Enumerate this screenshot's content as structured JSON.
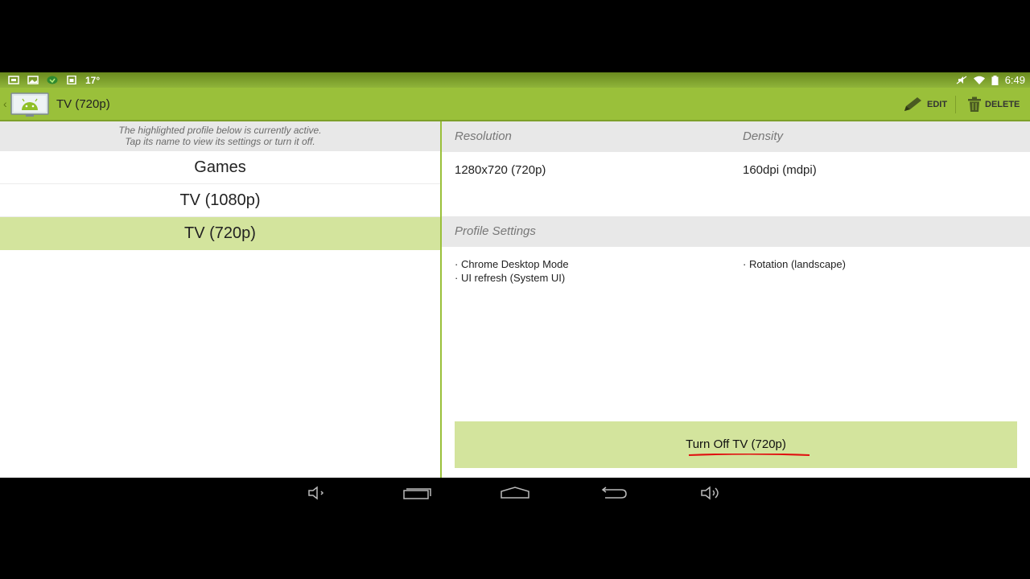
{
  "status_bar": {
    "temperature": "17°",
    "time": "6:49",
    "icons": [
      "screenshot-icon",
      "gallery-icon",
      "shield-icon",
      "sd-card-icon",
      "mute-icon",
      "wifi-icon",
      "battery-icon"
    ]
  },
  "action_bar": {
    "title": "TV (720p)",
    "edit_label": "EDIT",
    "delete_label": "DELETE"
  },
  "profiles": {
    "hint_line1": "The highlighted profile below is currently active.",
    "hint_line2": "Tap its name to view its settings or turn it off.",
    "items": [
      {
        "label": "Games",
        "active": false
      },
      {
        "label": "TV (1080p)",
        "active": false
      },
      {
        "label": "TV (720p)",
        "active": true
      }
    ]
  },
  "details": {
    "resolution_header": "Resolution",
    "density_header": "Density",
    "resolution_value": "1280x720 (720p)",
    "density_value": "160dpi (mdpi)",
    "settings_header": "Profile Settings",
    "settings": [
      "· Chrome Desktop Mode",
      "· UI refresh (System UI)",
      "· Rotation (landscape)"
    ],
    "turn_off_label": "Turn Off TV (720p)"
  },
  "colors": {
    "accent": "#9ac03a",
    "active_row": "#d3e49d",
    "annotation": "#e01010"
  }
}
